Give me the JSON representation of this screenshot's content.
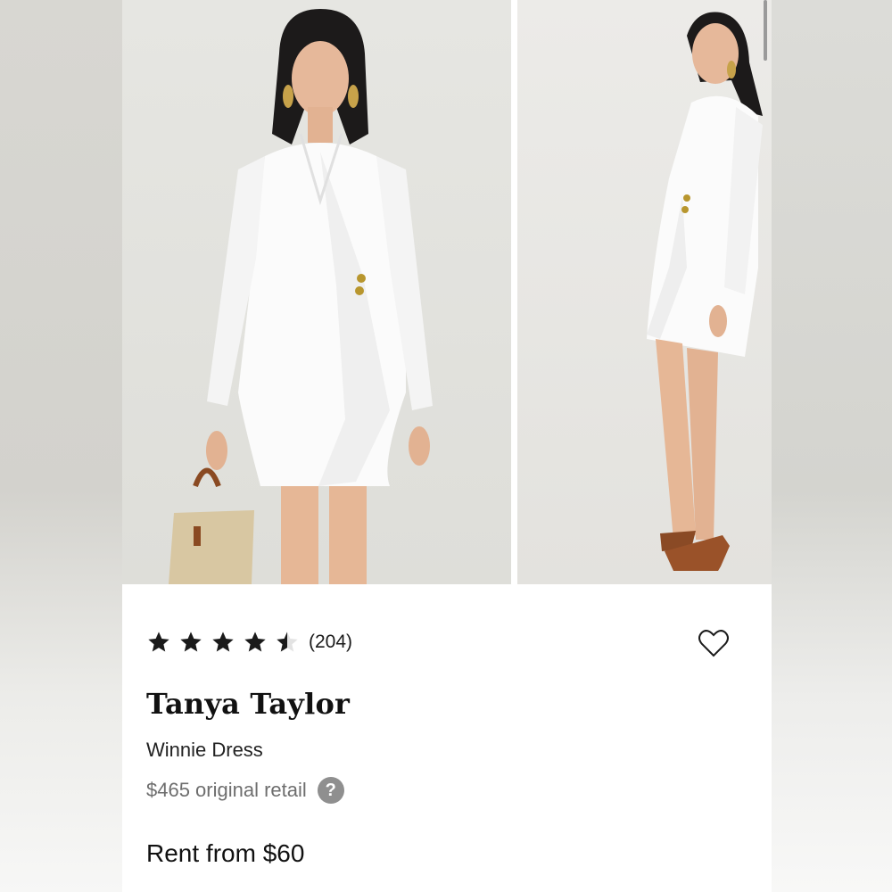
{
  "product": {
    "rating": 4.5,
    "rating_max": 5,
    "review_count": "(204)",
    "brand": "Tanya Taylor",
    "name": "Winnie Dress",
    "original_retail": "$465 original retail",
    "rent_price": "Rent from $60"
  },
  "icons": {
    "favorite": "heart-icon",
    "help": "question-icon",
    "rating": "star-icon"
  },
  "colors": {
    "star": "#1a1a1a",
    "help_badge": "#8f8f8f",
    "retail_text": "#6e6e6e"
  }
}
